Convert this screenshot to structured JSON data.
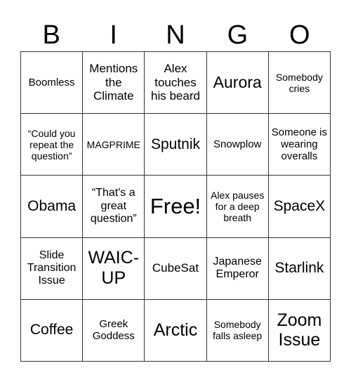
{
  "header": [
    "B",
    "I",
    "N",
    "G",
    "O"
  ],
  "cells": [
    [
      "Boomless",
      "Mentions the Climate",
      "Alex touches his beard",
      "Aurora",
      "Somebody cries"
    ],
    [
      "“Could you repeat the question”",
      "MAGPRIME",
      "Sputnik",
      "Snowplow",
      "Someone is wearing overalls"
    ],
    [
      "Obama",
      "“That's a great question”",
      "Free!",
      "Alex pauses for a deep breath",
      "SpaceX"
    ],
    [
      "Slide Transition Issue",
      "WAIC-UP",
      "CubeSat",
      "Japanese Emperor",
      "Starlink"
    ],
    [
      "Coffee",
      "Greek Goddess",
      "Arctic",
      "Somebody falls asleep",
      "Zoom Issue"
    ]
  ]
}
